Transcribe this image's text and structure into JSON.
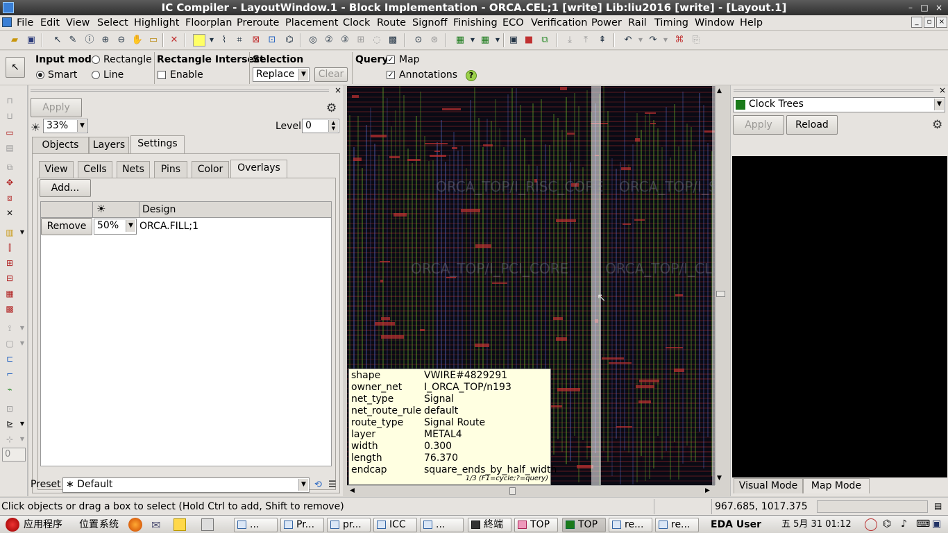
{
  "window": {
    "title": "IC Compiler - LayoutWindow.1 - Block Implementation - ORCA.CEL;1 [write]      Lib:liu2016 [write] - [Layout.1]",
    "controls": [
      "–",
      "□",
      "×"
    ]
  },
  "menu": [
    "File",
    "Edit",
    "View",
    "Select",
    "Highlight",
    "Floorplan",
    "Preroute",
    "Placement",
    "Clock",
    "Route",
    "Signoff",
    "Finishing",
    "ECO",
    "Verification",
    "Power",
    "Rail",
    "Timing",
    "Window",
    "Help"
  ],
  "options": {
    "input_mode_label": "Input mode",
    "rectangle": "Rectangle",
    "smart": "Smart",
    "line": "Line",
    "rect_intersect_label": "Rectangle Intersect",
    "enable": "Enable",
    "selection_label": "Selection",
    "selection_value": "Replace",
    "clear": "Clear",
    "query_label": "Query",
    "map": "Map",
    "annotations": "Annotations",
    "help": "?"
  },
  "left_panel": {
    "apply": "Apply",
    "brightness": "33%",
    "level_label": "Level",
    "level_value": "0",
    "tabs": [
      "Objects",
      "Layers",
      "Settings"
    ],
    "subtabs": [
      "View",
      "Cells",
      "Nets",
      "Pins",
      "Color",
      "Overlays"
    ],
    "add": "Add...",
    "grid_headers": [
      "",
      "",
      "Design"
    ],
    "row": {
      "remove": "Remove",
      "opacity": "50%",
      "design": "ORCA.FILL;1"
    },
    "preset_label": "Preset",
    "preset_value": "∗ Default"
  },
  "layout_labels": [
    "ORCA_TOP/I_RISC_CORE",
    "ORCA_TOP/I_SDRAM_IF",
    "ORCA_TOP/I_PCI_CORE",
    "ORCA_TOP/I_CLOCKING"
  ],
  "tooltip": {
    "rows": [
      {
        "k": "shape",
        "v": "VWIRE#4829291"
      },
      {
        "k": "owner_net",
        "v": "I_ORCA_TOP/n193"
      },
      {
        "k": "net_type",
        "v": "Signal"
      },
      {
        "k": "net_route_rule",
        "v": "default"
      },
      {
        "k": "route_type",
        "v": "Signal  Route"
      },
      {
        "k": "layer",
        "v": "METAL4"
      },
      {
        "k": "width",
        "v": "0.300"
      },
      {
        "k": "length",
        "v": "76.370"
      },
      {
        "k": "endcap",
        "v": "square_ends_by_half_width"
      }
    ],
    "footer": "1/3 (F1=cycle;?=query)"
  },
  "right_panel": {
    "dropdown": "Clock Trees",
    "apply": "Apply",
    "reload": "Reload",
    "tabs": [
      "Visual Mode",
      "Map Mode"
    ]
  },
  "status": {
    "message": "Click objects or drag a box to select (Hold Ctrl to add, Shift to remove)",
    "coords": "967.685, 1017.375"
  },
  "taskbar": {
    "menus": [
      "应用程序",
      "位置",
      "系统"
    ],
    "tasks": [
      "...",
      "Pr...",
      "pr...",
      "ICC",
      "...",
      "終端",
      "TOP",
      "TOP",
      "re...",
      "re..."
    ],
    "user": "EDA User",
    "clock": "五 5月 31 01:12"
  },
  "colors": {
    "canvas": "#0a0a14",
    "metal_green": "#6fbf2a",
    "metal_red": "#c03030",
    "metal_blue": "#5a6fd0",
    "tooltip_bg": "#ffffe1"
  }
}
